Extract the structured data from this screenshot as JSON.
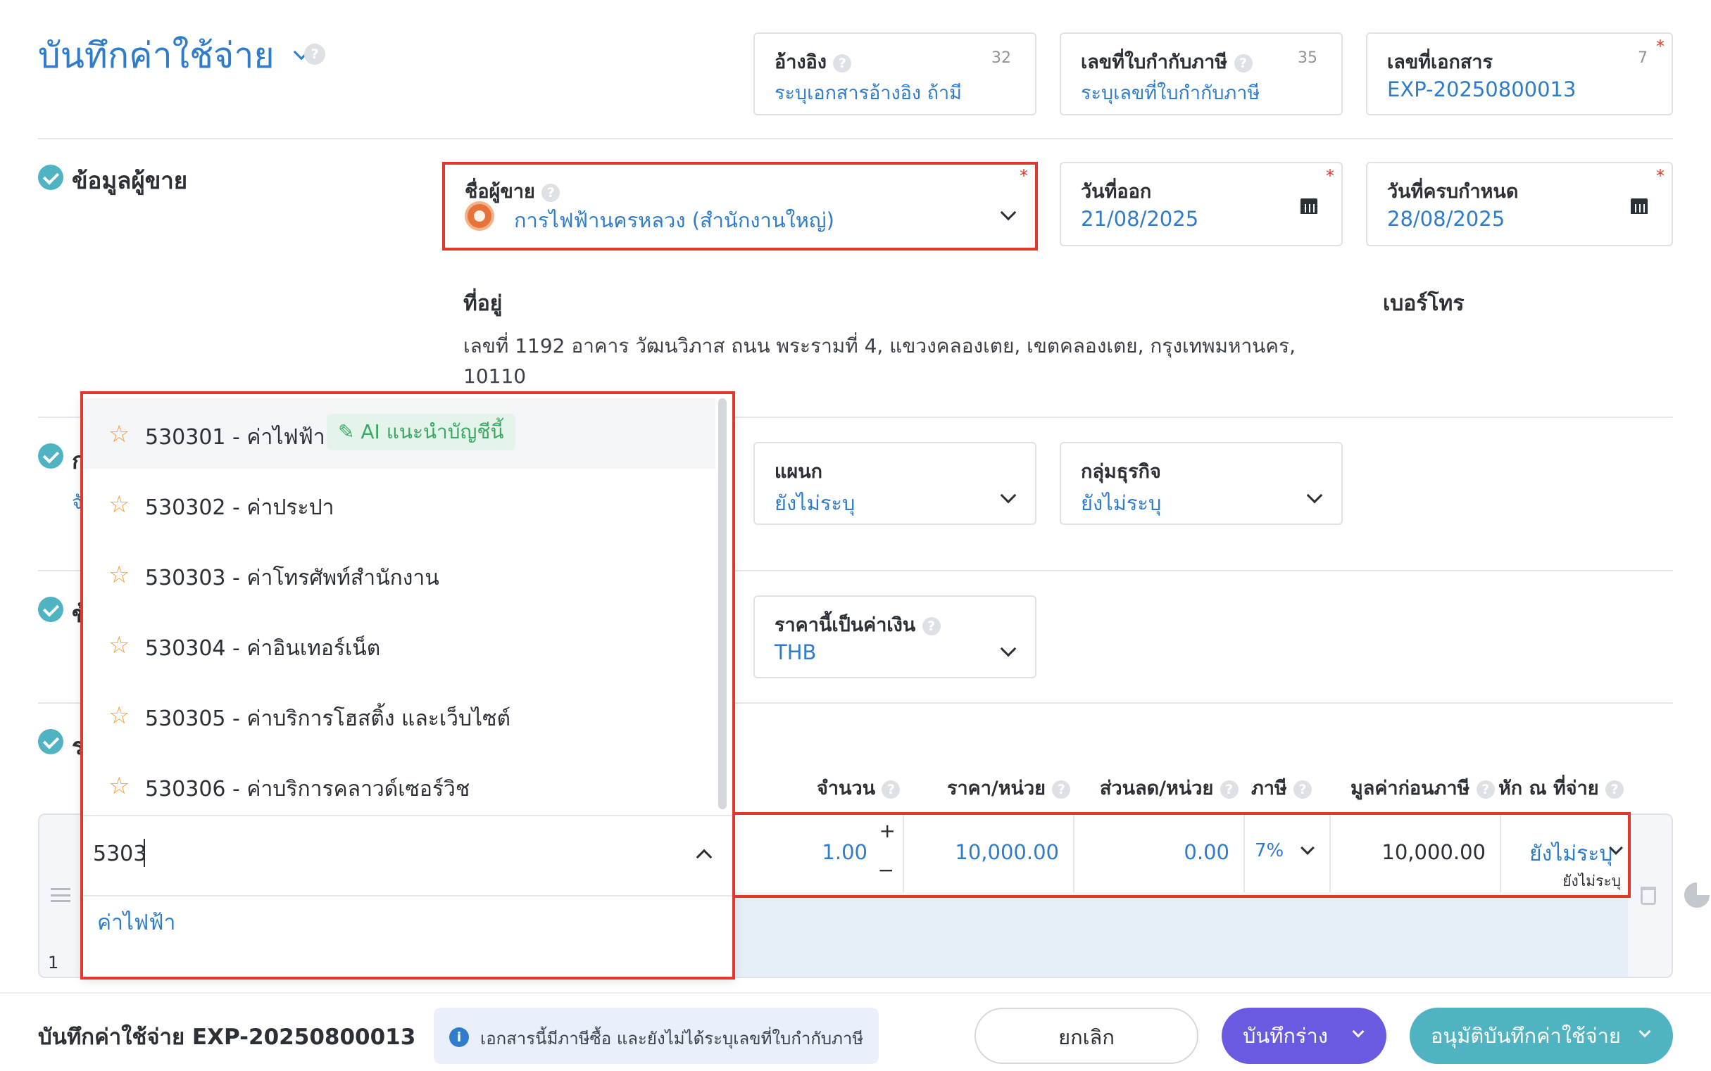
{
  "header": {
    "title": "บันทึกค่าใช้จ่าย",
    "reference": {
      "label": "อ้างอิง",
      "count": "32",
      "placeholder": "ระบุเอกสารอ้างอิง ถ้ามี"
    },
    "tax_invoice": {
      "label": "เลขที่ใบกำกับภาษี",
      "count": "35",
      "placeholder": "ระบุเลขที่ใบกำกับภาษี"
    },
    "doc_no": {
      "label": "เลขที่เอกสาร",
      "count": "7",
      "value": "EXP-20250800013"
    }
  },
  "vendor_section": {
    "title": "ข้อมูลผู้ขาย",
    "vendor": {
      "label": "ชื่อผู้ขาย",
      "value": "การไฟฟ้านครหลวง (สำนักงานใหญ่)"
    },
    "issue_date": {
      "label": "วันที่ออก",
      "value": "21/08/2025"
    },
    "due_date": {
      "label": "วันที่ครบกำหนด",
      "value": "28/08/2025"
    },
    "address": {
      "label": "ที่อยู่",
      "line1": "เลขที่ 1192 อาคาร วัฒนวิภาส ถนน พระรามที่ 4, แขวงคลองเตย, เขตคลองเตย, กรุงเทพมหานคร,",
      "line2": "10110"
    },
    "phone_label": "เบอร์โทร"
  },
  "section2": {
    "partial_title": "ก",
    "partial_sub": "จั",
    "department": {
      "label": "แผนก",
      "value": "ยังไม่ระบุ"
    },
    "business_group": {
      "label": "กลุ่มธุรกิจ",
      "value": "ยังไม่ระบุ"
    }
  },
  "section3": {
    "partial_title": "ข้",
    "currency": {
      "label": "ราคานี้เป็นค่าเงิน",
      "value": "THB"
    }
  },
  "section4": {
    "partial_title": "ร"
  },
  "dropdown": {
    "items": [
      {
        "text": "530301 - ค่าไฟฟ้า",
        "badge": "AI แนะนำบัญชีนี้"
      },
      {
        "text": "530302 - ค่าประปา"
      },
      {
        "text": "530303 - ค่าโทรศัพท์สำนักงาน"
      },
      {
        "text": "530304 - ค่าอินเทอร์เน็ต"
      },
      {
        "text": "530305 - ค่าบริการโฮสติ้ง และเว็บไซต์"
      },
      {
        "text": "530306 - ค่าบริการคลาวด์เซอร์วิช"
      }
    ],
    "search_value": "5303",
    "description": "ค่าไฟฟ้า"
  },
  "table": {
    "headers": {
      "qty": "จำนวน",
      "price": "ราคา/หน่วย",
      "discount": "ส่วนลด/หน่วย",
      "tax": "ภาษี",
      "pretax": "มูลค่าก่อนภาษี",
      "withholding": "หัก ณ ที่จ่าย"
    },
    "row": {
      "index": "1",
      "qty": "1.00",
      "price": "10,000.00",
      "discount": "0.00",
      "tax": "7%",
      "pretax": "10,000.00",
      "withholding": "ยังไม่ระบุ",
      "withholding_sub": "ยังไม่ระบุ"
    }
  },
  "footer": {
    "title": "บันทึกค่าใช้จ่าย EXP-20250800013",
    "notice": "เอกสารนี้มีภาษีซื้อ และยังไม่ได้ระบุเลขที่ใบกำกับภาษี",
    "cancel": "ยกเลิก",
    "draft": "บันทึกร่าง",
    "approve": "อนุมัติบันทึกค่าใช้จ่าย"
  },
  "colors": {
    "accent": "#2f7ccc",
    "highlight": "#e0392b",
    "draft": "#6a5ae0",
    "approve": "#4fb3c1",
    "teal_check": "#4fb3c1",
    "ai_badge": "#3aa864"
  }
}
